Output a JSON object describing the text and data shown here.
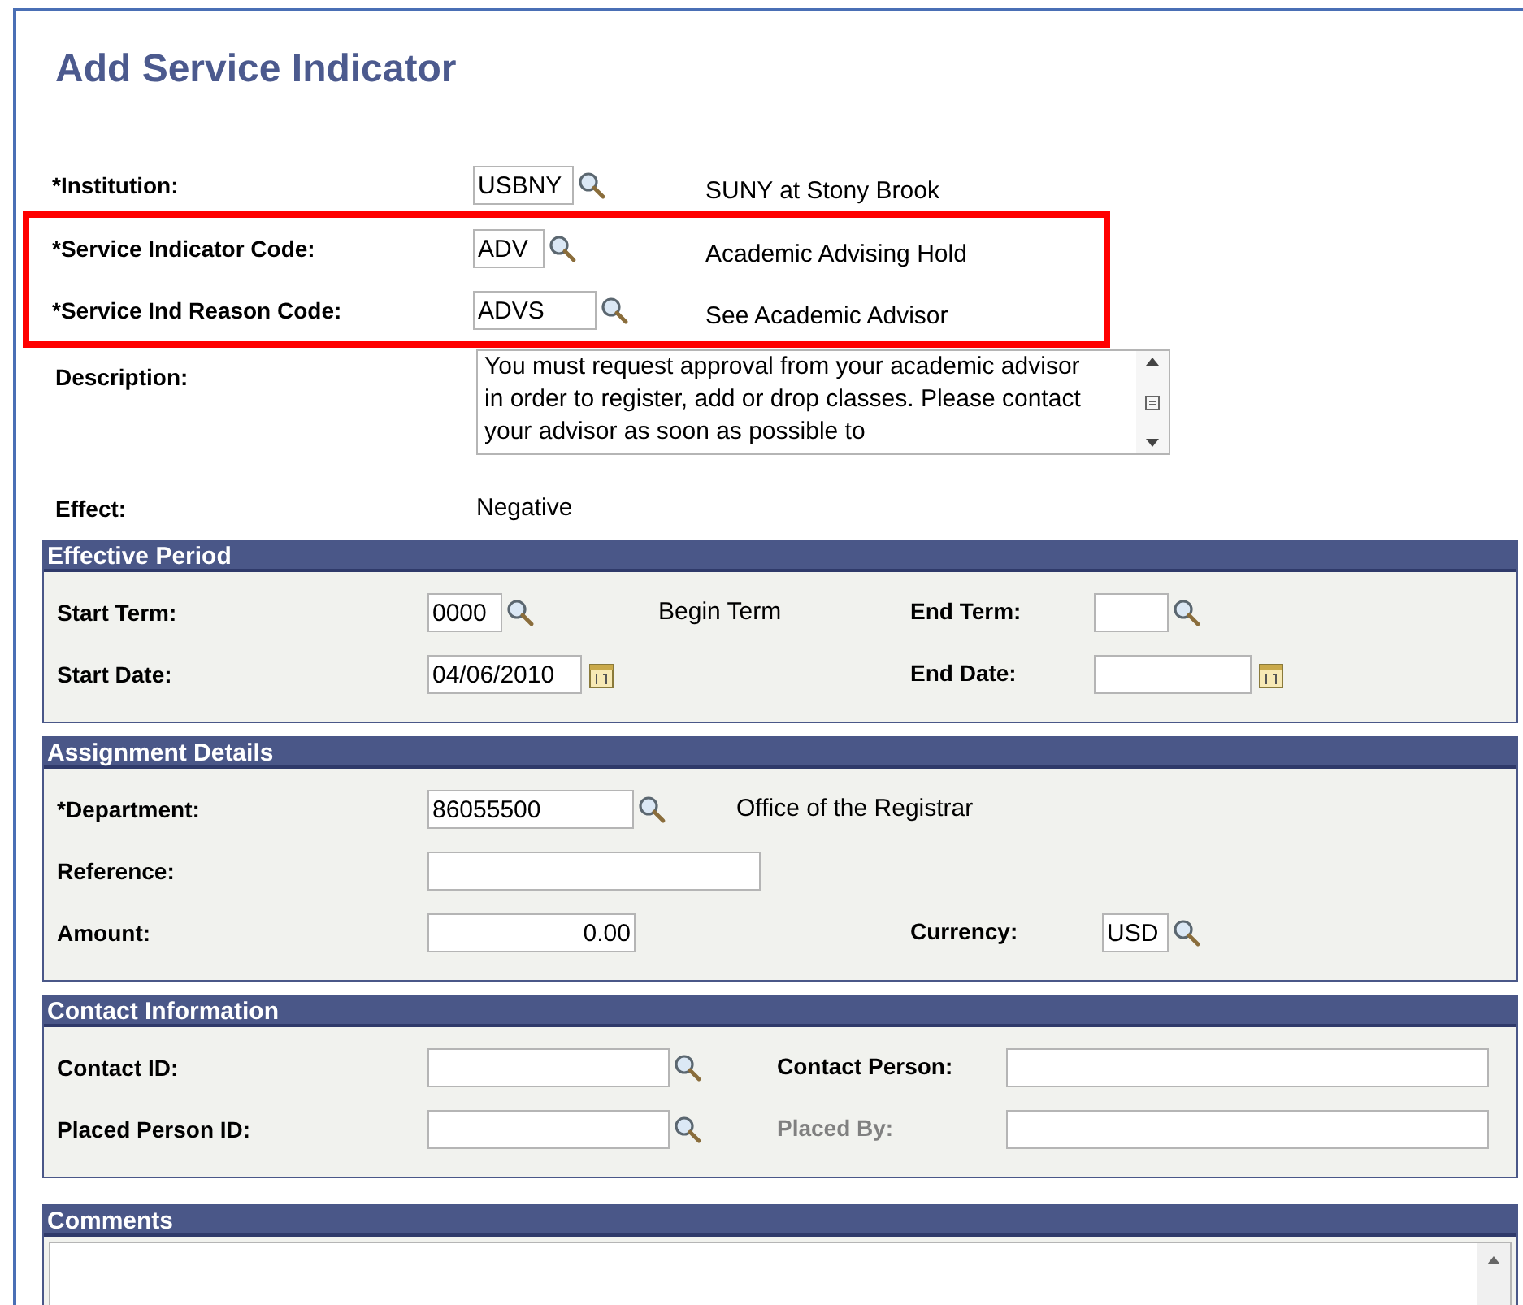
{
  "title": "Add Service Indicator",
  "fields": [
    {
      "label": "*Institution:",
      "field": {
        "kind": "lookup",
        "value": "USBNY"
      },
      "note": "SUNY at Stony Brook",
      "highlighted": false
    },
    {
      "label": "*Service Indicator Code:",
      "field": {
        "kind": "lookup",
        "value": "ADV"
      },
      "note": "Academic Advising Hold",
      "highlighted": true
    },
    {
      "label": "*Service Ind Reason Code:",
      "field": {
        "kind": "lookup",
        "value": "ADVS"
      },
      "note": "See Academic Advisor",
      "highlighted": true
    }
  ],
  "description": {
    "label": "Description:",
    "value": "You must request approval from your academic advisor in order to register, add or drop classes. Please contact your advisor as soon as possible to"
  },
  "effect": {
    "label": "Effect:",
    "value": "Negative"
  },
  "sections": [
    {
      "title": "Effective Period",
      "rows": [
        {
          "label": "Start Term:",
          "field": {
            "kind": "lookup",
            "value": "0000"
          },
          "note": "Begin Term",
          "right": {
            "label": "End Term:",
            "disabled": false,
            "field": {
              "kind": "lookup"
            }
          }
        },
        {
          "label": "Start Date:",
          "field": {
            "kind": "date",
            "value": "04/06/2010"
          },
          "right": {
            "label": "End Date:",
            "disabled": false,
            "field": {
              "kind": "date"
            }
          }
        }
      ]
    },
    {
      "title": "Assignment Details",
      "rows": [
        {
          "label": "*Department:",
          "field": {
            "kind": "lookup",
            "value": "86055500"
          },
          "note": "Office of the Registrar"
        },
        {
          "label": "Reference:",
          "field": {
            "kind": "text"
          }
        },
        {
          "label": "Amount:",
          "field": {
            "kind": "number",
            "value": "0.00"
          },
          "right": {
            "label": "Currency:",
            "disabled": false,
            "field": {
              "kind": "lookup",
              "value": "USD"
            }
          }
        }
      ]
    },
    {
      "title": "Contact Information",
      "rows": [
        {
          "label": "Contact ID:",
          "field": {
            "kind": "lookup"
          },
          "right": {
            "label": "Contact Person:",
            "disabled": false,
            "field": {
              "kind": "text"
            }
          }
        },
        {
          "label": "Placed Person ID:",
          "field": {
            "kind": "lookup"
          },
          "right": {
            "label": "Placed By:",
            "disabled": true,
            "field": {
              "kind": "text"
            }
          }
        }
      ]
    }
  ],
  "comments": {
    "title": "Comments"
  }
}
